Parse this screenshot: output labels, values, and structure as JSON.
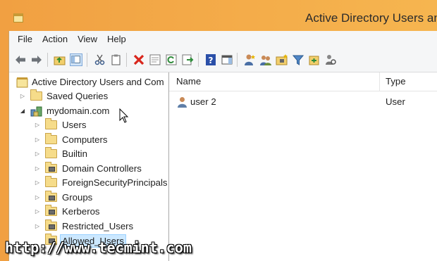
{
  "window": {
    "title": "Active Directory Users and",
    "icon": "app-folder-icon"
  },
  "menu": [
    "File",
    "Action",
    "View",
    "Help"
  ],
  "toolbar": {
    "buttons": [
      "back-arrow-icon",
      "forward-arrow-icon",
      "up-folder-icon",
      "show-console-tree-icon",
      "cut-icon",
      "copy-icon",
      "delete-icon",
      "properties-icon",
      "refresh-icon",
      "export-list-icon",
      "help-icon",
      "show-action-pane-icon",
      "create-user-icon",
      "create-group-icon",
      "create-ou-icon",
      "filter-icon",
      "add-to-group-icon",
      "delegate-control-icon"
    ]
  },
  "tree": {
    "root": "Active Directory Users and Com",
    "saved_queries": "Saved Queries",
    "domain": "mydomain.com",
    "children": [
      "Users",
      "Computers",
      "Builtin",
      "Domain Controllers",
      "ForeignSecurityPrincipals",
      "Groups",
      "Kerberos",
      "Restricted_Users",
      "Allowed_Users"
    ],
    "selected": "Allowed_Users"
  },
  "list": {
    "columns": [
      "Name",
      "Type"
    ],
    "rows": [
      {
        "name": "user 2",
        "type": "User",
        "icon": "user-icon"
      }
    ]
  },
  "watermark": "http://www.tecmint.com",
  "colors": {
    "desktop": "#f3a746",
    "selection": "#cce8ff",
    "folder": "#f6dc8a",
    "delete_red": "#d9261c",
    "help_blue": "#2a4fa8"
  }
}
